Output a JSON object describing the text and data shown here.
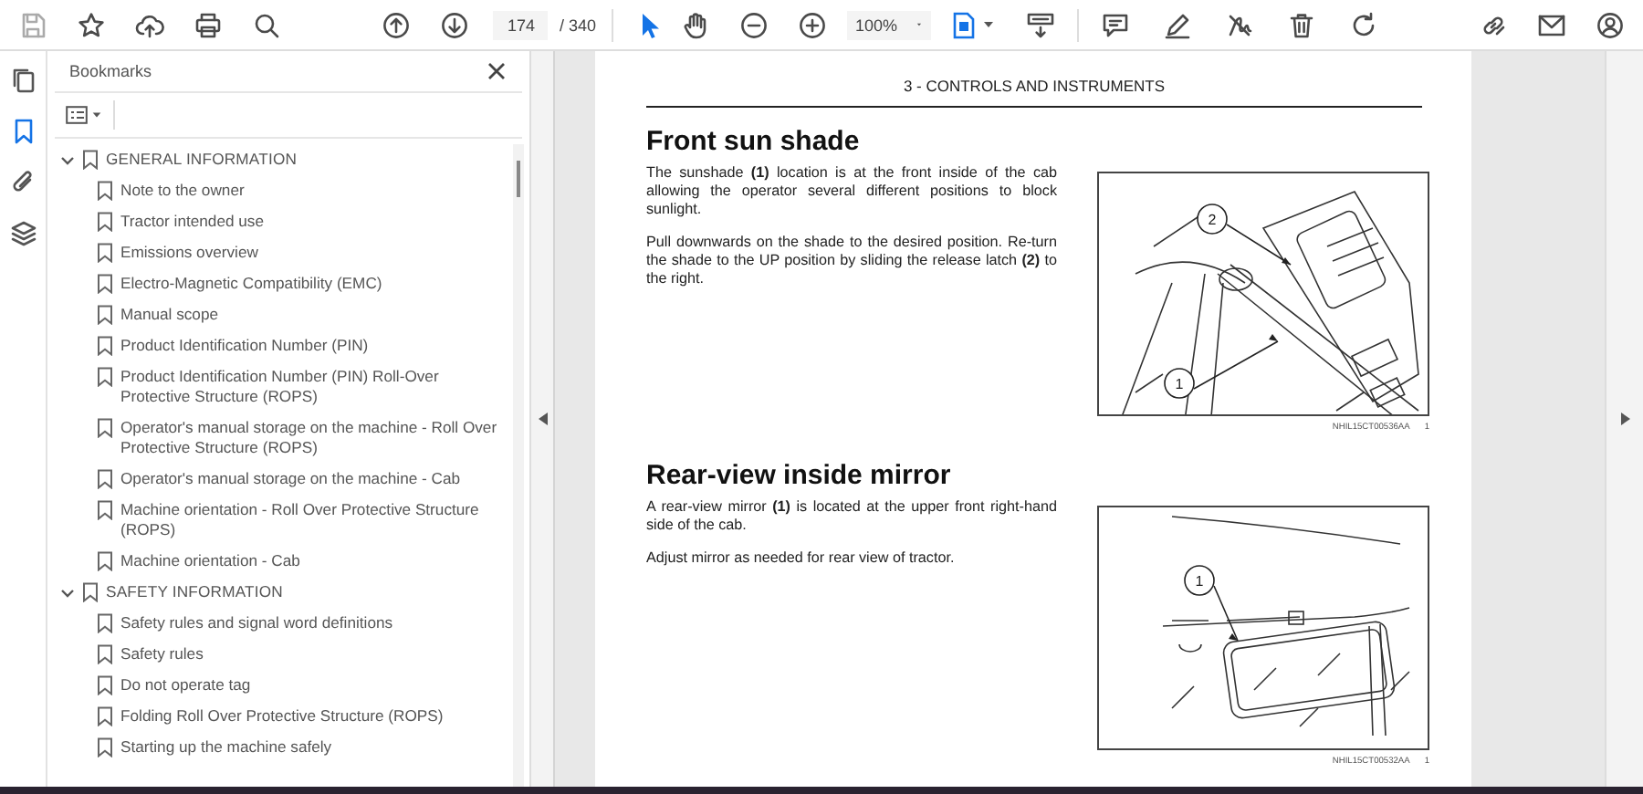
{
  "toolbar": {
    "tools": [
      {
        "kind": "select",
        "selected": true
      },
      {
        "kind": "hand",
        "selected": false
      }
    ],
    "page_field": "174",
    "page_count": "/ 340",
    "zoom": "100%"
  },
  "sidebar_tabs": [
    {
      "kind": "pages",
      "selected": false
    },
    {
      "kind": "bookmarks",
      "selected": true
    },
    {
      "kind": "attachments",
      "selected": false
    },
    {
      "kind": "layers",
      "selected": false
    }
  ],
  "bookmarks": {
    "title": "Bookmarks",
    "items": [
      {
        "label": "GENERAL INFORMATION",
        "expanded": true,
        "children": [
          {
            "label": "Note to the owner"
          },
          {
            "label": "Tractor intended use"
          },
          {
            "label": "Emissions overview"
          },
          {
            "label": "Electro-Magnetic Compatibility (EMC)"
          },
          {
            "label": "Manual scope"
          },
          {
            "label": "Product Identification Number (PIN)"
          },
          {
            "label": "Product Identification Number (PIN) Roll-Over Protective Structure (ROPS)"
          },
          {
            "label": "Operator's manual storage on the machine - Roll Over Protective Structure (ROPS)"
          },
          {
            "label": "Operator's manual storage on the machine - Cab"
          },
          {
            "label": "Machine orientation - Roll Over Protective Structure (ROPS)"
          },
          {
            "label": "Machine orientation - Cab"
          }
        ]
      },
      {
        "label": "SAFETY INFORMATION",
        "expanded": true,
        "children": [
          {
            "label": "Safety rules and signal word definitions"
          },
          {
            "label": "Safety rules"
          },
          {
            "label": "Do not operate tag"
          },
          {
            "label": "Folding Roll Over Protective Structure (ROPS)"
          },
          {
            "label": "Starting up the machine safely"
          }
        ]
      }
    ]
  },
  "document": {
    "header": "3 - CONTROLS AND INSTRUMENTS",
    "sections": [
      {
        "heading": "Front sun shade",
        "paragraphs": [
          "The sunshade **(1)** location is at the front inside of the cab allowing the operator several different positions to block sunlight.",
          "Pull downwards on the shade to the desired position. Re-turn the shade to the UP position by sliding the release latch **(2)** to the right."
        ],
        "figure": {
          "kind": "sun-shade",
          "callouts": [
            "2",
            "1"
          ],
          "code": "NHIL15CT00536AA",
          "number": "1"
        }
      },
      {
        "heading": "Rear-view inside mirror",
        "paragraphs": [
          "A rear-view mirror **(1)** is located at the upper front right-hand side of the cab.",
          "Adjust mirror as needed for rear view of tractor."
        ],
        "figure": {
          "kind": "mirror",
          "callouts": [
            "1"
          ],
          "code": "NHIL15CT00532AA",
          "number": "1"
        }
      }
    ]
  }
}
